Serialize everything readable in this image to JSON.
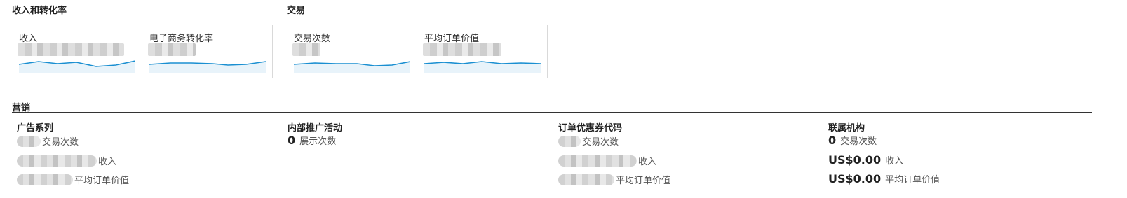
{
  "revenue_conversion": {
    "title": "收入和转化率",
    "cards": [
      {
        "label": "收入"
      },
      {
        "label": "电子商务转化率"
      }
    ]
  },
  "transactions": {
    "title": "交易",
    "cards": [
      {
        "label": "交易次数"
      },
      {
        "label": "平均订单价值"
      }
    ]
  },
  "marketing": {
    "title": "营销",
    "columns": [
      {
        "title": "广告系列",
        "rows": [
          {
            "value": "",
            "label": "交易次数"
          },
          {
            "value": "",
            "label": "收入"
          },
          {
            "value": "",
            "label": "平均订单价值"
          }
        ]
      },
      {
        "title": "内部推广活动",
        "rows": [
          {
            "value": "0",
            "label": "展示次数"
          }
        ]
      },
      {
        "title": "订单优惠券代码",
        "rows": [
          {
            "value": "",
            "label": "交易次数"
          },
          {
            "value": "",
            "label": "收入"
          },
          {
            "value": "",
            "label": "平均订单价值"
          }
        ]
      },
      {
        "title": "联属机构",
        "rows": [
          {
            "value": "0",
            "label": "交易次数"
          },
          {
            "value": "US$0.00",
            "label": "收入"
          },
          {
            "value": "US$0.00",
            "label": "平均订单价值"
          }
        ]
      }
    ]
  },
  "colors": {
    "sparkline": "#1a8fd1",
    "sparkfill": "#e8f3fa",
    "rule": "#333333"
  }
}
